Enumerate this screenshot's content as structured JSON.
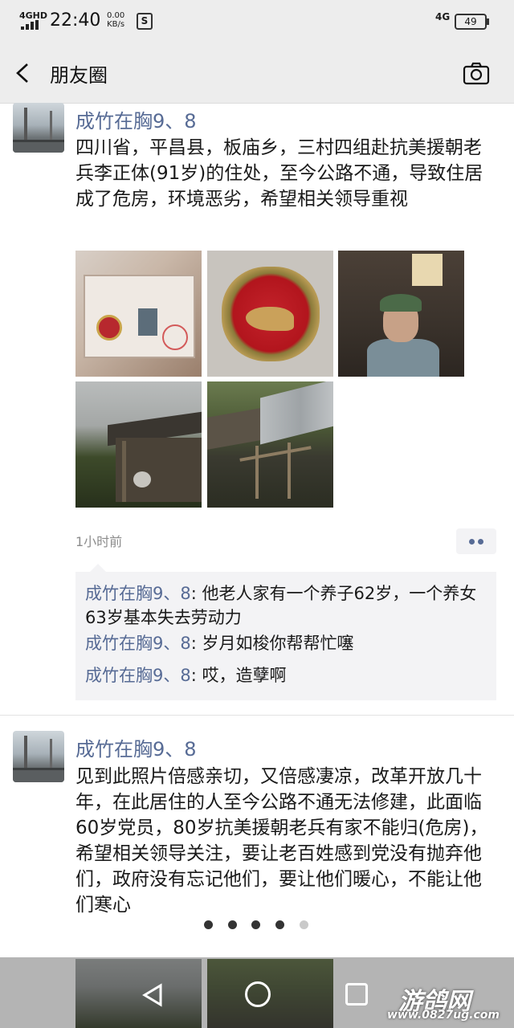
{
  "status_bar": {
    "network": "4GHD",
    "time": "22:40",
    "speed_value": "0.00",
    "speed_unit": "KB/s",
    "s_icon_label": "S",
    "network_right": "4G",
    "battery": "49"
  },
  "nav": {
    "title": "朋友圈",
    "back_icon": "chevron-left-icon",
    "camera_icon": "camera-icon"
  },
  "post1": {
    "username": "成竹在胸9、8",
    "text": "四川省，平昌县，板庙乡，三村四组赴抗美援朝老兵李正体(91岁)的住处，至今公路不通，导致住居成了危房，环境恶劣，希望相关领导重视",
    "time": "1小时前",
    "photo_count": 5,
    "comments": [
      {
        "name": "成竹在胸9、8",
        "text": ": 他老人家有一个养子62岁，一个养女63岁基本失去劳动力"
      },
      {
        "name": "成竹在胸9、8",
        "text": ": 岁月如梭你帮帮忙噻"
      },
      {
        "name": "成竹在胸9、8",
        "text": ": 哎，造孽啊"
      }
    ]
  },
  "post2": {
    "username": "成竹在胸9、8",
    "text": "见到此照片倍感亲切，又倍感凄凉，改革开放几十年，在此居住的人至今公路不通无法修建，此面临60岁党员，80岁抗美援朝老兵有家不能归(危房)，希望相关领导关注，要让老百姓感到党没有抛弃他们，政府没有忘记他们，要让他们暖心，不能让他们寒心"
  },
  "pager": {
    "total": 5,
    "active": 5
  },
  "watermark": {
    "name": "游鸽网",
    "url": "www.0827ug.com"
  }
}
